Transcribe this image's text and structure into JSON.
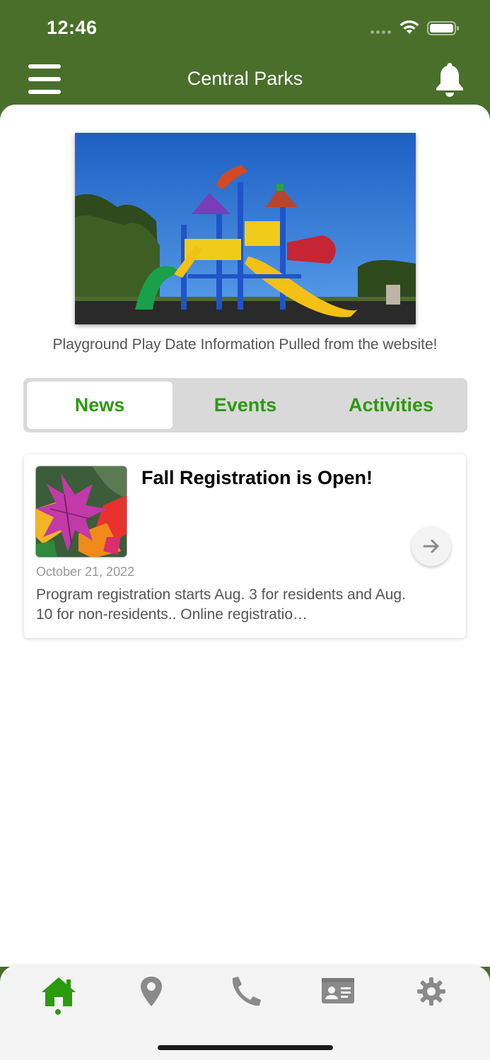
{
  "status_bar": {
    "time": "12:46"
  },
  "header": {
    "title": "Central Parks"
  },
  "hero": {
    "caption": "Playground Play Date Information Pulled from the website!"
  },
  "tabs": [
    {
      "label": "News",
      "active": true
    },
    {
      "label": "Events",
      "active": false
    },
    {
      "label": "Activities",
      "active": false
    }
  ],
  "news": [
    {
      "title": "Fall Registration is Open!",
      "date": "October 21, 2022",
      "summary": "Program registration starts Aug. 3 for residents and Aug. 10 for non-residents.. Online registratio…"
    }
  ],
  "bottom_nav": {
    "items": [
      "home-icon",
      "location-pin-icon",
      "phone-icon",
      "contact-card-icon",
      "gear-icon"
    ],
    "active": "home-icon"
  },
  "colors": {
    "header_bg": "#4a6f2b",
    "accent": "#2b9a0f",
    "tab_bg": "#d9d9d9",
    "inactive_icon": "#8a8a8a"
  }
}
